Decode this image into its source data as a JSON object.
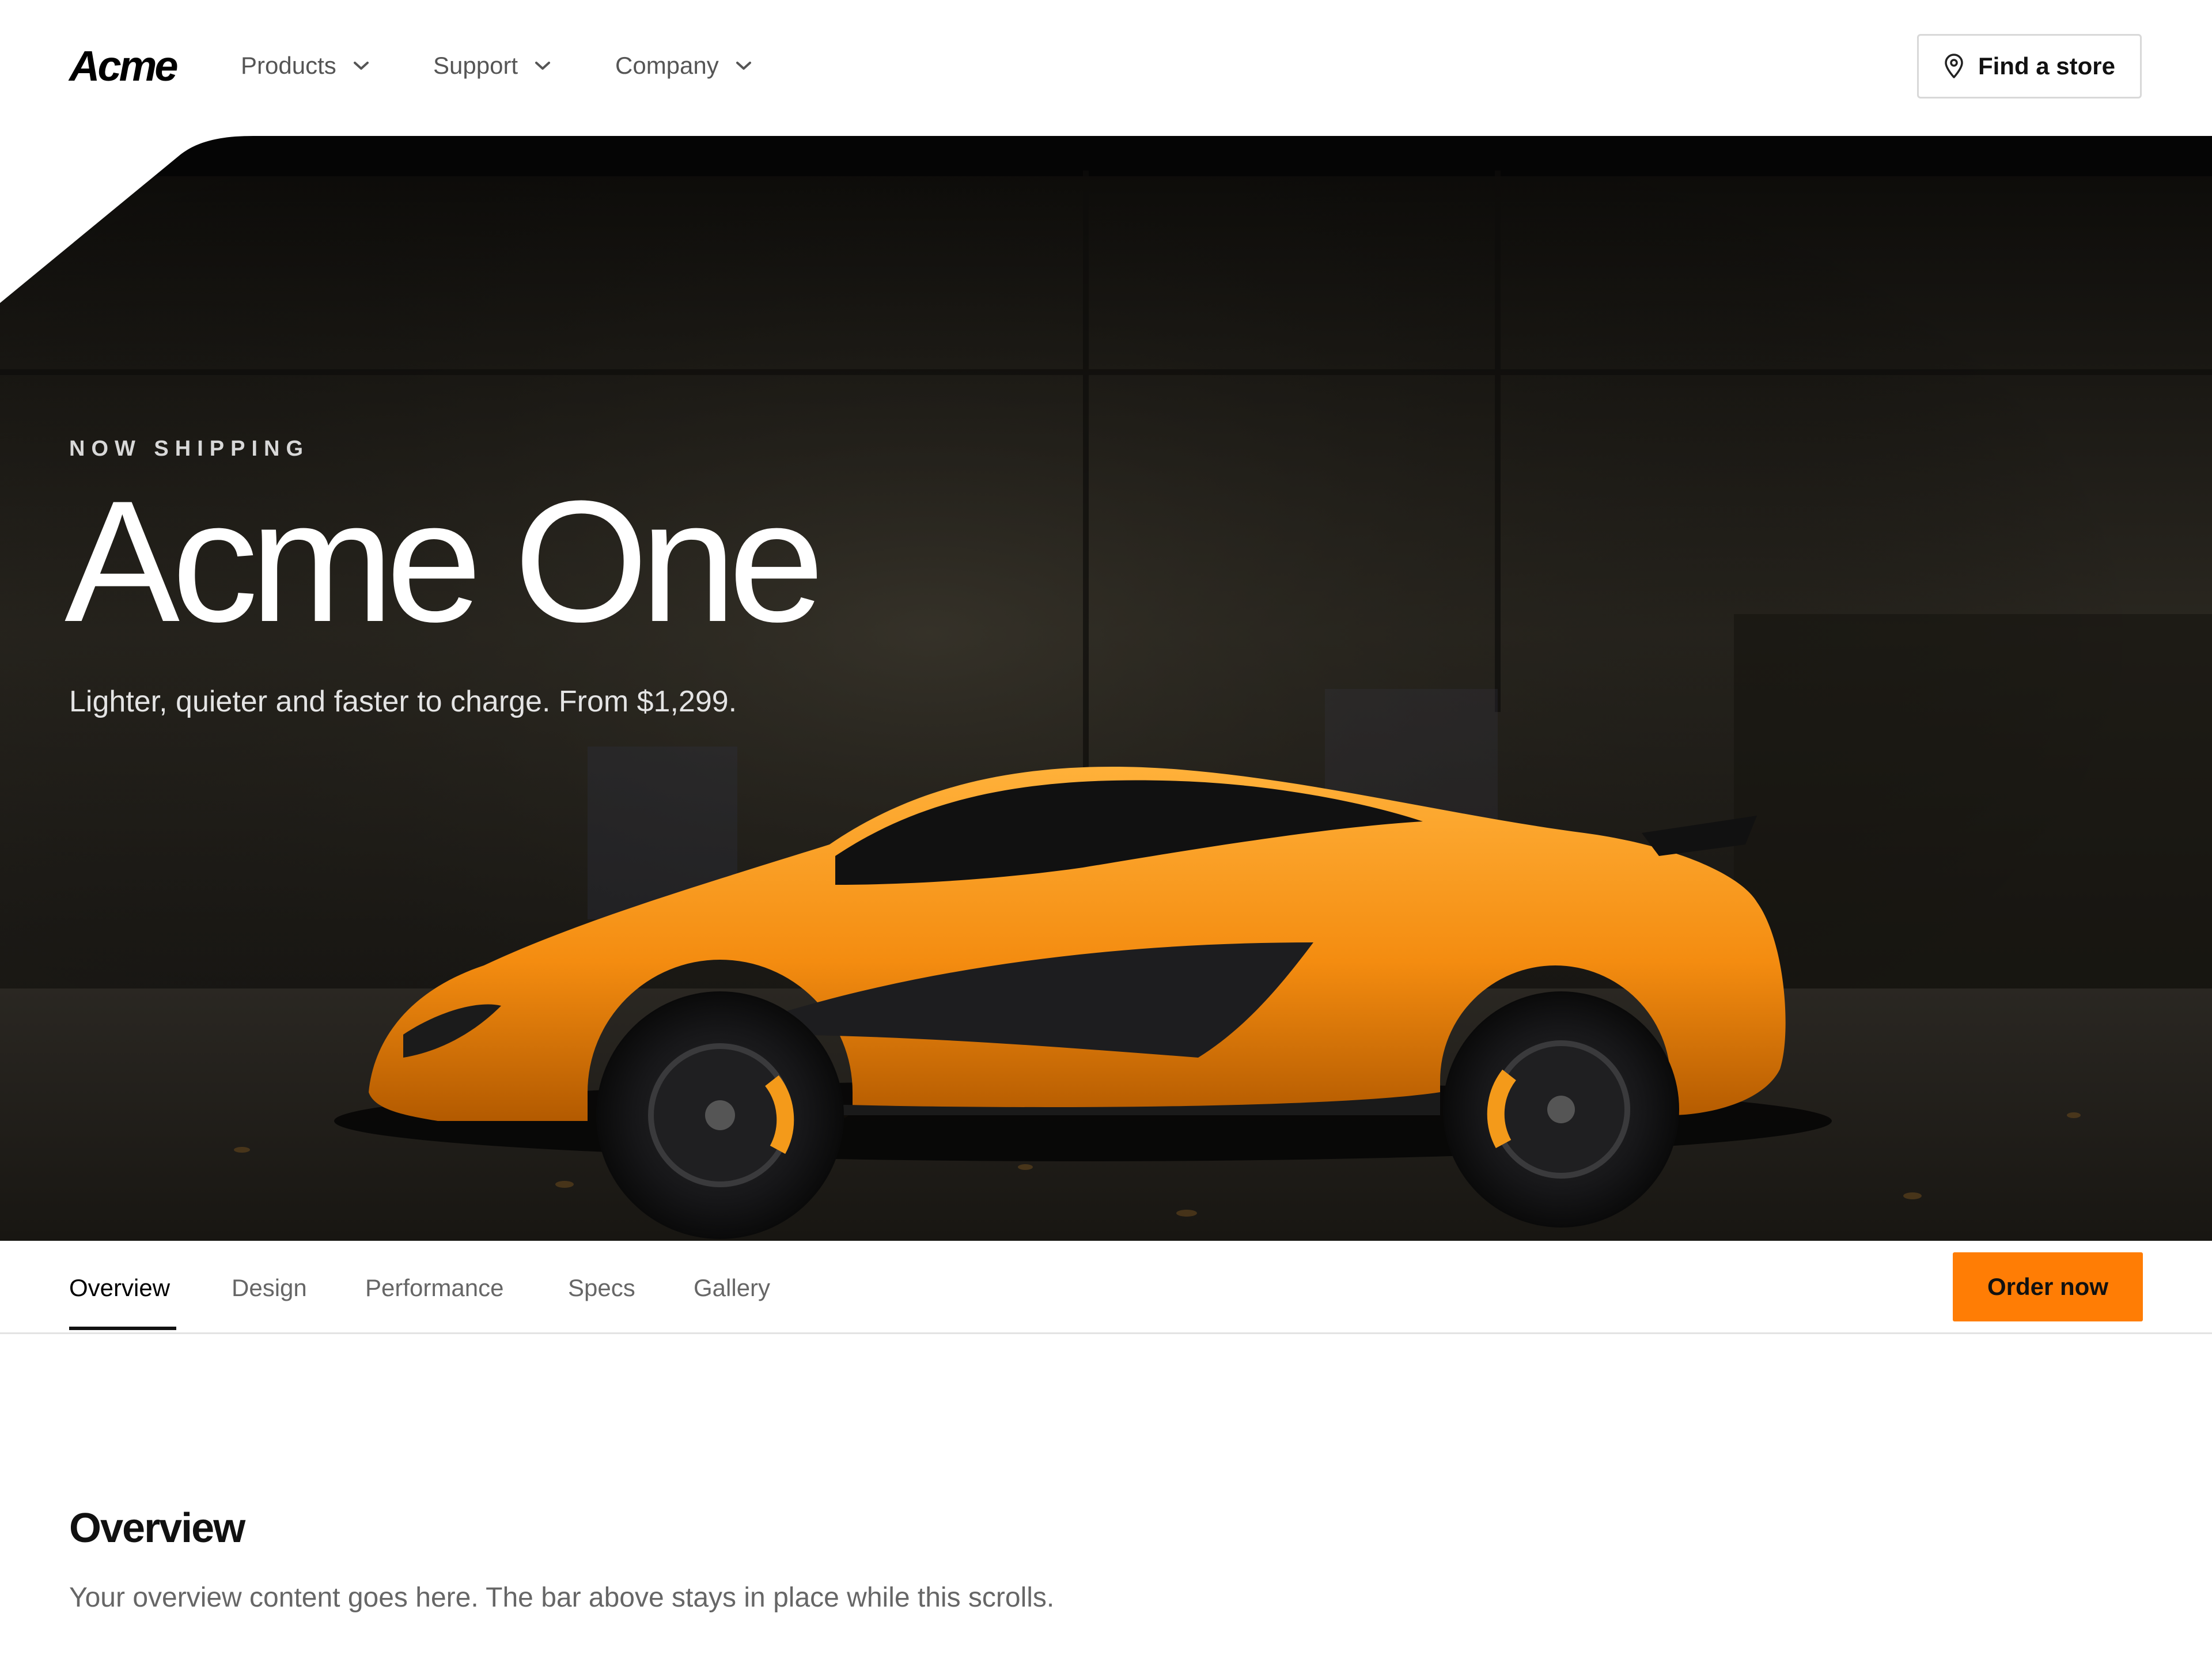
{
  "header": {
    "logo": "Acme",
    "nav": [
      {
        "label": "Products",
        "icon": "chevron-down-icon"
      },
      {
        "label": "Support",
        "icon": "chevron-down-icon"
      },
      {
        "label": "Company",
        "icon": "chevron-down-icon"
      }
    ],
    "store_button": {
      "label": "Find a store",
      "icon": "map-pin-icon"
    }
  },
  "hero": {
    "eyebrow": "NOW SHIPPING",
    "title": "Acme One",
    "subtitle": "Lighter, quieter and faster to charge. From $1,299.",
    "image": "orange-sports-car-photo"
  },
  "tabbar": {
    "tabs": [
      {
        "label": "Overview",
        "active": true
      },
      {
        "label": "Design",
        "active": false
      },
      {
        "label": "Performance",
        "active": false
      },
      {
        "label": "Specs",
        "active": false
      },
      {
        "label": "Gallery",
        "active": false
      }
    ],
    "cta": "Order now"
  },
  "section": {
    "title": "Overview",
    "body": "Your overview content goes here. The bar above stays in place while this scrolls."
  },
  "colors": {
    "accent": "#ff7d05",
    "text": "#111111",
    "muted": "#666666"
  }
}
